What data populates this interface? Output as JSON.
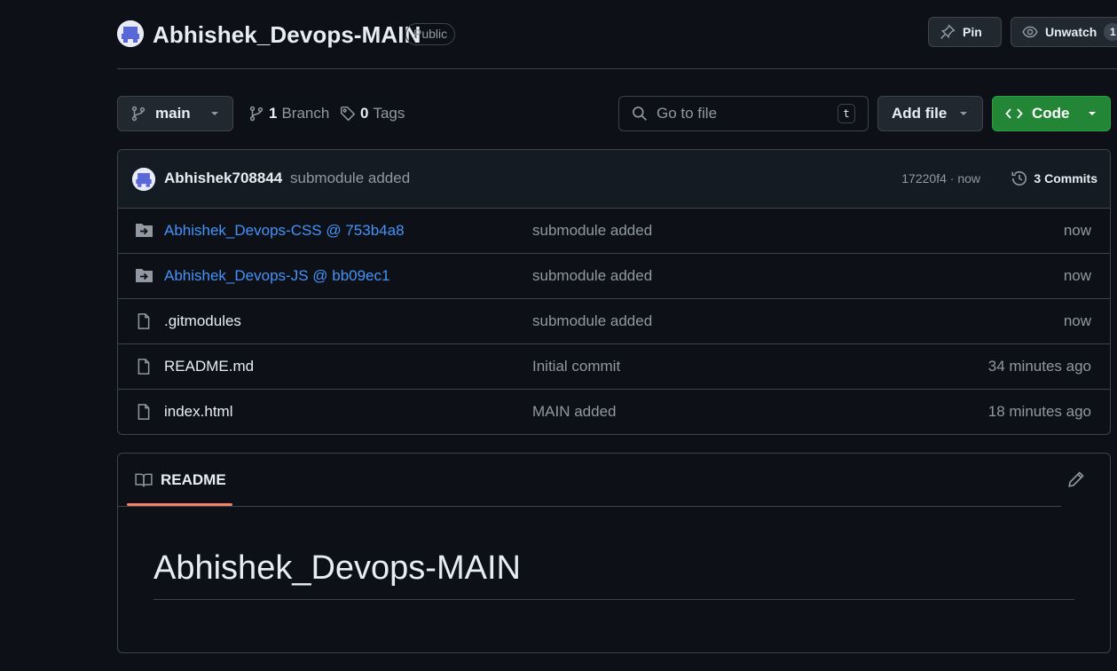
{
  "repo": {
    "name": "Abhishek_Devops-MAIN",
    "visibility": "Public",
    "pin_label": "Pin",
    "watch_label": "Unwatch",
    "watch_count": "1"
  },
  "toolbar": {
    "branch": "main",
    "branch_count": "1",
    "branch_label": "Branch",
    "tag_count": "0",
    "tag_label": "Tags",
    "search_placeholder": "Go to file",
    "search_shortcut": "t",
    "add_file_label": "Add file",
    "code_label": "Code"
  },
  "latest_commit": {
    "author": "Abhishek708844",
    "message": "submodule added",
    "hash_time": "17220f4 · now",
    "commits_label": "3 Commits"
  },
  "files": [
    {
      "name": "Abhishek_Devops-CSS @ 753b4a8",
      "type": "submodule",
      "message": "submodule added",
      "age": "now"
    },
    {
      "name": "Abhishek_Devops-JS @ bb09ec1",
      "type": "submodule",
      "message": "submodule added",
      "age": "now"
    },
    {
      "name": ".gitmodules",
      "type": "file",
      "message": "submodule added",
      "age": "now"
    },
    {
      "name": "README.md",
      "type": "file",
      "message": "Initial commit",
      "age": "34 minutes ago"
    },
    {
      "name": "index.html",
      "type": "file",
      "message": "MAIN added",
      "age": "18 minutes ago"
    }
  ],
  "readme": {
    "tab_label": "README",
    "heading": "Abhishek_Devops-MAIN"
  },
  "colors": {
    "background": "#0d1117",
    "accent_green": "#238636",
    "link_blue": "#4493f8",
    "tab_underline": "#f78166"
  }
}
